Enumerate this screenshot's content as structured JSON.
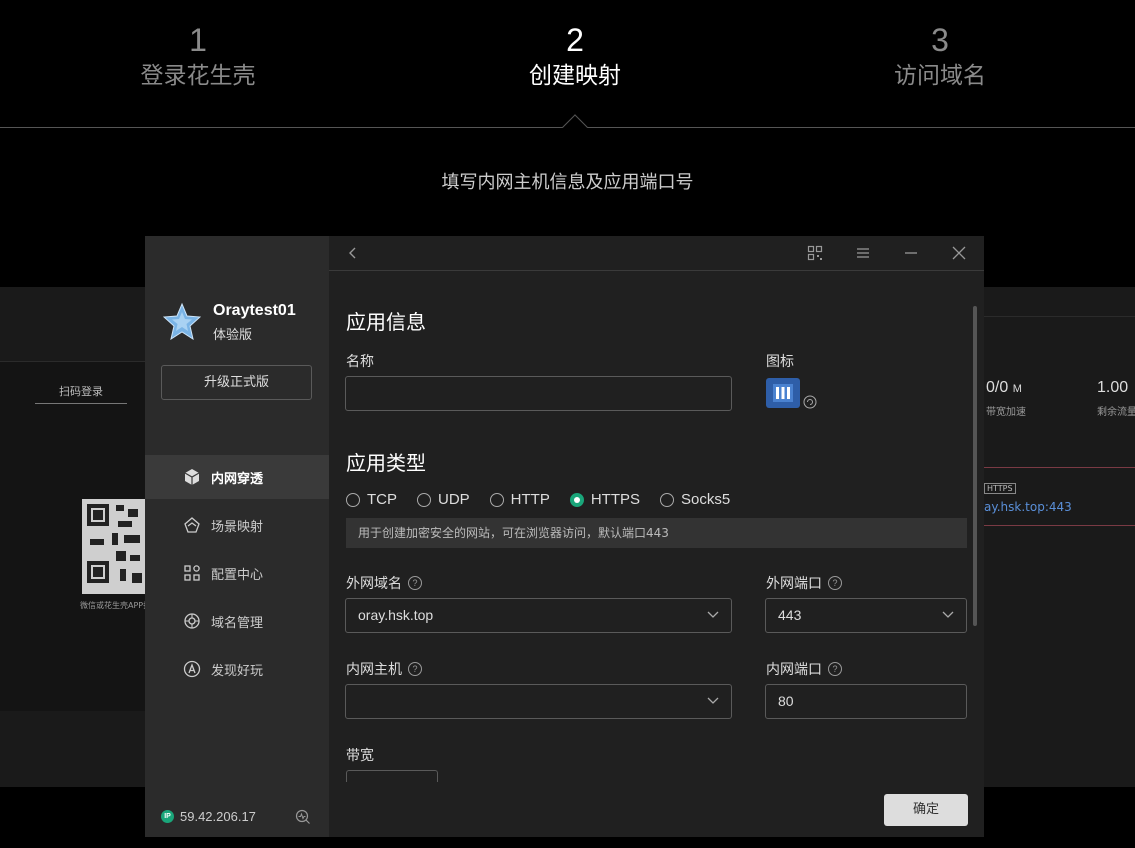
{
  "steps": [
    {
      "num": "1",
      "label": "登录花生壳"
    },
    {
      "num": "2",
      "label": "创建映射"
    },
    {
      "num": "3",
      "label": "访问域名"
    }
  ],
  "subtitle": "填写内网主机信息及应用端口号",
  "background_left": {
    "tab": "扫码登录",
    "caption": "微信或花生壳APP扫码"
  },
  "background_right": {
    "stat1_value": "0/0",
    "stat1_unit": "M",
    "stat1_caption": "带宽加速",
    "stat2_value": "1.00",
    "stat2_caption": "剩余流量",
    "badge": "HTTPS",
    "link": "ay.hsk.top:443"
  },
  "sidebar": {
    "username": "Oraytest01",
    "edition": "体验版",
    "upgrade_label": "升级正式版",
    "items": [
      {
        "label": "内网穿透",
        "icon": "cube-icon",
        "active": true
      },
      {
        "label": "场景映射",
        "icon": "scene-icon",
        "active": false
      },
      {
        "label": "配置中心",
        "icon": "grid-settings-icon",
        "active": false
      },
      {
        "label": "域名管理",
        "icon": "domain-icon",
        "active": false
      },
      {
        "label": "发现好玩",
        "icon": "discover-icon",
        "active": false
      }
    ],
    "ip_badge": "IP",
    "ip": "59.42.206.17"
  },
  "form": {
    "app_info_title": "应用信息",
    "name_label": "名称",
    "name_value": "",
    "icon_label": "图标",
    "app_type_title": "应用类型",
    "types": [
      "TCP",
      "UDP",
      "HTTP",
      "HTTPS",
      "Socks5"
    ],
    "selected_type": "HTTPS",
    "hint": "用于创建加密安全的网站，可在浏览器访问，默认端口443",
    "external_domain_label": "外网域名",
    "external_domain_value": "oray.hsk.top",
    "external_port_label": "外网端口",
    "external_port_value": "443",
    "internal_host_label": "内网主机",
    "internal_host_value": "",
    "internal_port_label": "内网端口",
    "internal_port_value": "80",
    "bandwidth_label": "带宽",
    "confirm_label": "确定"
  },
  "colors": {
    "accent": "#1aa67a",
    "app_icon": "#2e5ea8",
    "link": "#5a8fd8"
  }
}
